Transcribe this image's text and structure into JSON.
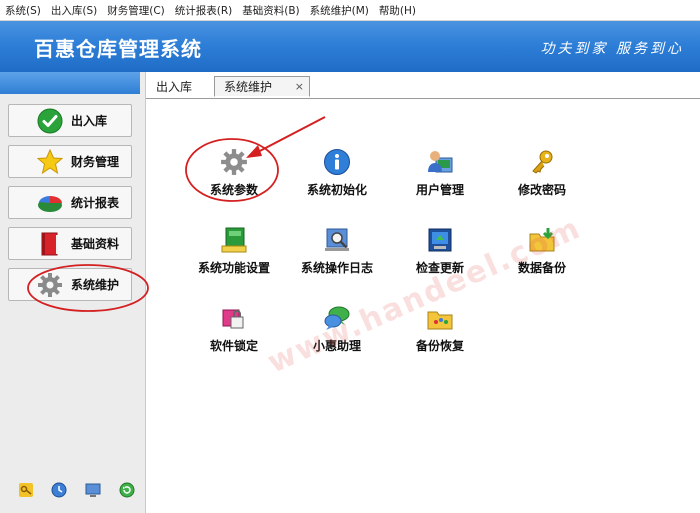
{
  "menu": [
    "系统(S)",
    "出入库(S)",
    "财务管理(C)",
    "统计报表(R)",
    "基础资料(B)",
    "系统维护(M)",
    "帮助(H)"
  ],
  "header": {
    "title": "百惠仓库管理系统",
    "slogan": "功夫到家 服务到心"
  },
  "sidebar": {
    "items": [
      {
        "label": "出入库",
        "icon": "check-icon"
      },
      {
        "label": "财务管理",
        "icon": "star-icon"
      },
      {
        "label": "统计报表",
        "icon": "pie-chart-icon"
      },
      {
        "label": "基础资料",
        "icon": "book-icon"
      },
      {
        "label": "系统维护",
        "icon": "gear-icon"
      }
    ],
    "bottom_icons": [
      "key-icon",
      "clock-icon",
      "monitor-icon",
      "refresh-icon"
    ]
  },
  "tabs": [
    {
      "label": "出入库",
      "active": false
    },
    {
      "label": "系统维护",
      "active": true,
      "close": "×"
    }
  ],
  "tiles": [
    {
      "label": "系统参数",
      "icon": "gear-icon"
    },
    {
      "label": "系统初始化",
      "icon": "info-icon"
    },
    {
      "label": "用户管理",
      "icon": "user-icon"
    },
    {
      "label": "修改密码",
      "icon": "key-icon"
    },
    {
      "label": "系统功能设置",
      "icon": "settings-icon"
    },
    {
      "label": "系统操作日志",
      "icon": "log-icon"
    },
    {
      "label": "检查更新",
      "icon": "update-icon"
    },
    {
      "label": "数据备份",
      "icon": "backup-icon"
    },
    {
      "label": "软件锁定",
      "icon": "lock-icon"
    },
    {
      "label": "小惠助理",
      "icon": "chat-icon"
    },
    {
      "label": "备份恢复",
      "icon": "palette-icon"
    }
  ],
  "watermark": "www.handeel.com",
  "colors": {
    "banner": "#2e7fd8",
    "annotation": "#d42020",
    "sidebar_bg": "#ececec"
  }
}
